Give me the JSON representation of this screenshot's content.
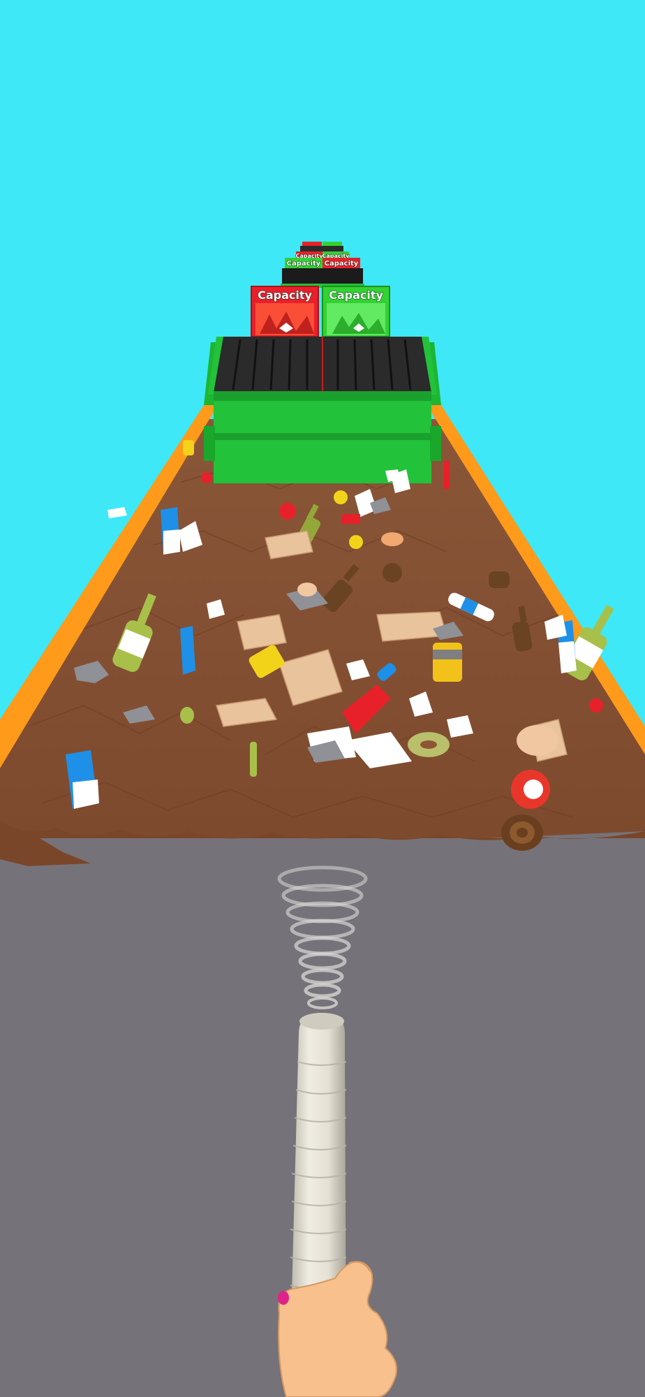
{
  "game": {
    "sky_color": "#3ee8f6",
    "road_color": "#767279",
    "dirt_color": "#8e5535",
    "rail_color": "#ff9a1a",
    "dumpster_color": "#22c23a",
    "bins": {
      "near_left": {
        "label": "Capacity",
        "color": "#e8202a"
      },
      "near_right": {
        "label": "Capacity",
        "color": "#33d233"
      },
      "far_left": {
        "label": "Capacity",
        "color": "#e8202a"
      },
      "far_right": {
        "label": "Capacity",
        "color": "#33d233"
      },
      "farther_left": {
        "label": "Capacity",
        "color": "#e8202a"
      },
      "farther_right": {
        "label": "Capacity",
        "color": "#33d233"
      }
    },
    "player": {
      "tool": "vacuum-hose",
      "hand": "hand-icon"
    }
  }
}
